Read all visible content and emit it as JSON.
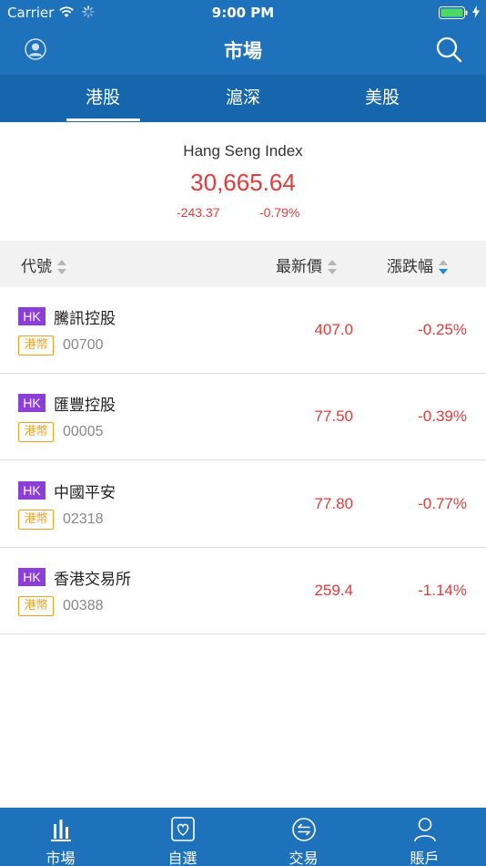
{
  "status_bar": {
    "carrier": "Carrier",
    "time": "9:00 PM"
  },
  "nav": {
    "title": "市場",
    "left_icon": "profile-icon",
    "right_icon": "search-icon"
  },
  "tabs": [
    {
      "label": "港股",
      "active": true
    },
    {
      "label": "滬深",
      "active": false
    },
    {
      "label": "美股",
      "active": false
    }
  ],
  "index": {
    "name": "Hang Seng Index",
    "value": "30,665.64",
    "change": "-243.37",
    "change_pct": "-0.79%"
  },
  "table": {
    "columns": [
      {
        "label": "代號",
        "sort": "none"
      },
      {
        "label": "最新價",
        "sort": "none"
      },
      {
        "label": "漲跌幅",
        "sort": "descending"
      }
    ],
    "rows": [
      {
        "market": "HK",
        "name": "騰訊控股",
        "currency": "港幣",
        "code": "00700",
        "price": "407.0",
        "change": "-0.25%"
      },
      {
        "market": "HK",
        "name": "匯豐控股",
        "currency": "港幣",
        "code": "00005",
        "price": "77.50",
        "change": "-0.39%"
      },
      {
        "market": "HK",
        "name": "中國平安",
        "currency": "港幣",
        "code": "02318",
        "price": "77.80",
        "change": "-0.77%"
      },
      {
        "market": "HK",
        "name": "香港交易所",
        "currency": "港幣",
        "code": "00388",
        "price": "259.4",
        "change": "-1.14%"
      }
    ]
  },
  "bottom_tabs": [
    {
      "label": "市場",
      "icon": "bar-chart-icon",
      "active": true
    },
    {
      "label": "自選",
      "icon": "heart-icon",
      "active": false
    },
    {
      "label": "交易",
      "icon": "exchange-icon",
      "active": false
    },
    {
      "label": "賬戶",
      "icon": "person-icon",
      "active": false
    }
  ],
  "colors": {
    "primary": "#1e72bb",
    "tab_bar": "#1666ad",
    "down": "#e23b3b",
    "market_badge": "#8c3fd6",
    "currency_badge": "#f0a020",
    "sort_active": "#1e88e5"
  }
}
